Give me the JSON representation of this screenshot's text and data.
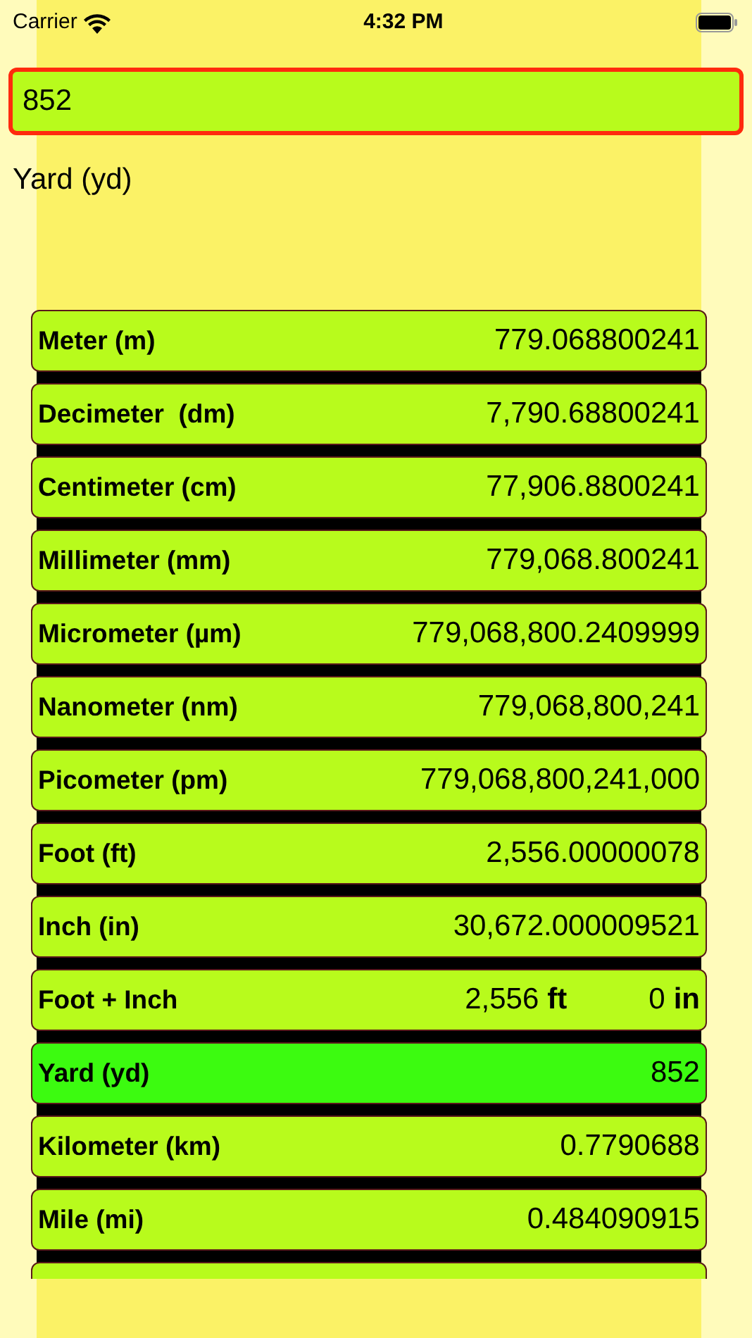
{
  "status_bar": {
    "carrier": "Carrier",
    "time": "4:32 PM"
  },
  "input": {
    "value": "852"
  },
  "unit_label": "Yard (yd)",
  "rows": [
    {
      "kind": "single",
      "label": "Meter (m)",
      "value": "779.068800241",
      "selected": false
    },
    {
      "kind": "single",
      "label": "Decimeter  (dm)",
      "value": "7,790.68800241",
      "selected": false
    },
    {
      "kind": "single",
      "label": "Centimeter (cm)",
      "value": "77,906.8800241",
      "selected": false
    },
    {
      "kind": "single",
      "label": "Millimeter (mm)",
      "value": "779,068.800241",
      "selected": false
    },
    {
      "kind": "single",
      "label": "Micrometer (µm)",
      "value": "779,068,800.2409999",
      "selected": false
    },
    {
      "kind": "single",
      "label": "Nanometer (nm)",
      "value": "779,068,800,241",
      "selected": false
    },
    {
      "kind": "single",
      "label": "Picometer (pm)",
      "value": "779,068,800,241,000",
      "selected": false
    },
    {
      "kind": "single",
      "label": "Foot (ft)",
      "value": "2,556.00000078",
      "selected": false
    },
    {
      "kind": "single",
      "label": "Inch (in)",
      "value": "30,672.000009521",
      "selected": false
    },
    {
      "kind": "compound",
      "label": "Foot + Inch",
      "parts": [
        {
          "value": "2,556",
          "unit": "ft"
        },
        {
          "value": "0",
          "unit": "in"
        }
      ],
      "selected": false
    },
    {
      "kind": "single",
      "label": "Yard (yd)",
      "value": "852",
      "selected": true
    },
    {
      "kind": "single",
      "label": "Kilometer (km)",
      "value": "0.7790688",
      "selected": false
    },
    {
      "kind": "single",
      "label": "Mile (mi)",
      "value": "0.484090915",
      "selected": false
    }
  ]
}
